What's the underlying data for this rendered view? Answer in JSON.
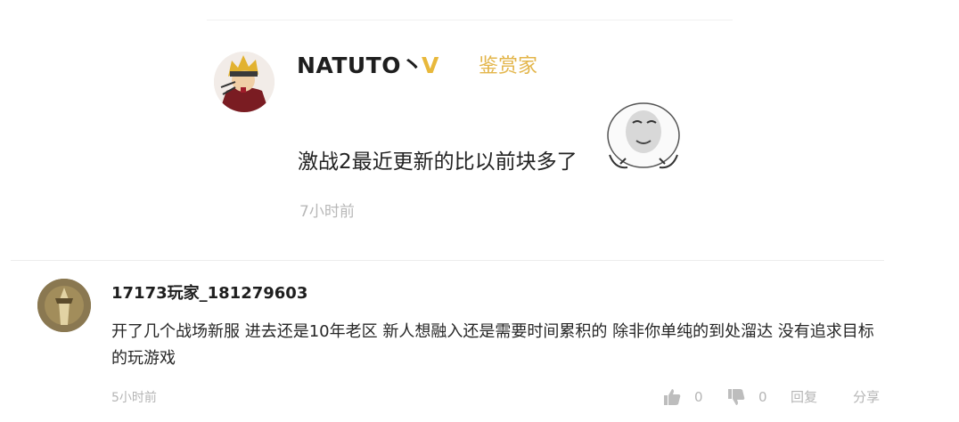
{
  "comment1": {
    "username": "NATUTO丶",
    "vip_mark": "V",
    "badge": "鉴赏家",
    "text": "激战2最近更新的比以前块多了",
    "time": "7小时前",
    "emoji": "meme-face-icon"
  },
  "comment2": {
    "username": "17173玩家_181279603",
    "text": "开了几个战场新服 进去还是10年老区 新人想融入还是需要时间累积的 除非你单纯的到处溜达 没有追求目标的玩游戏",
    "time": "5小时前",
    "actions": {
      "like_count": "0",
      "dislike_count": "0",
      "reply_label": "回复",
      "share_label": "分享"
    }
  },
  "colors": {
    "badge": "#e3b54a",
    "vip": "#e8b83b",
    "muted": "#b5b5b5"
  }
}
